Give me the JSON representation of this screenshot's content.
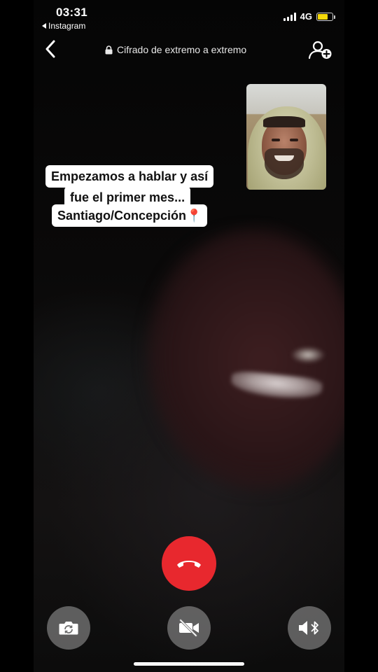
{
  "status_bar": {
    "time": "03:31",
    "back_app": "Instagram",
    "network": "4G"
  },
  "header": {
    "encryption_label": "Cifrado de extremo a extremo"
  },
  "caption": {
    "lines": [
      "Empezamos a hablar y así",
      "fue el primer mes...",
      "Santiago/Concepción📍"
    ]
  },
  "controls": {
    "end_call": "phone-hangup-icon",
    "flip_camera": "flip-camera-icon",
    "video_off": "video-off-icon",
    "speaker_bluetooth": "speaker-bluetooth-icon"
  },
  "colors": {
    "end_call": "#e8282e",
    "battery": "#f5d90a",
    "control_bg": "#a0a0a0"
  }
}
